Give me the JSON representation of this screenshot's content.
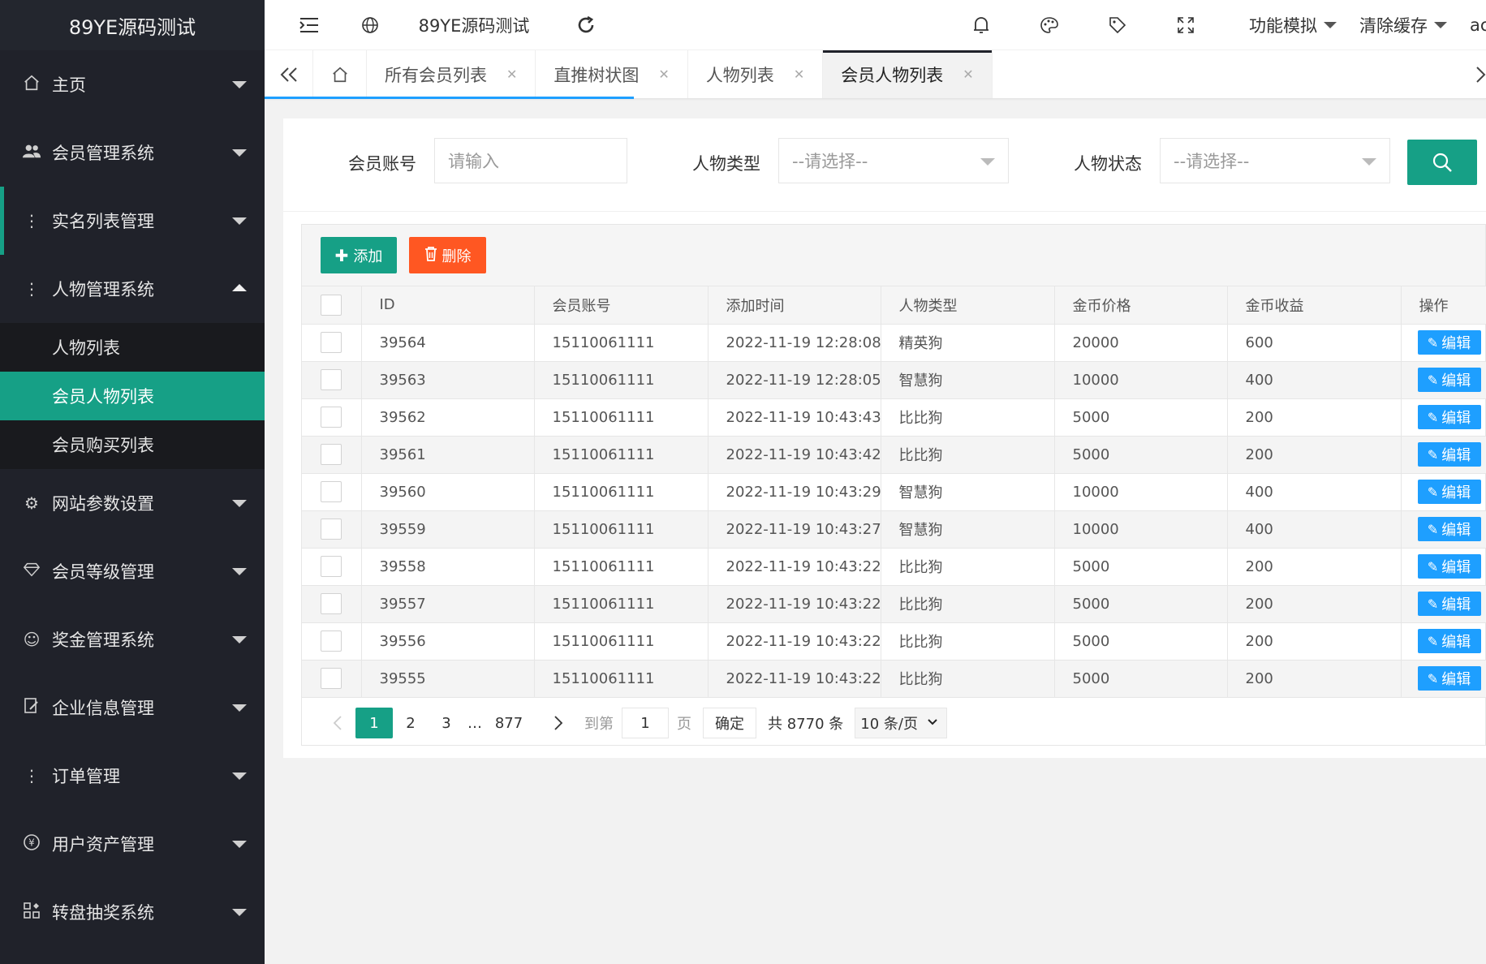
{
  "sidebar": {
    "logo": "89YE源码测试",
    "items": [
      {
        "label": "主页",
        "icon": "home-icon"
      },
      {
        "label": "会员管理系统",
        "icon": "users-icon"
      },
      {
        "label": "实名列表管理",
        "icon": "dots-vertical-icon"
      },
      {
        "label": "人物管理系统",
        "icon": "dots-vertical-icon"
      },
      {
        "label": "网站参数设置",
        "icon": "gear-icon"
      },
      {
        "label": "会员等级管理",
        "icon": "diamond-icon"
      },
      {
        "label": "奖金管理系统",
        "icon": "smile-icon"
      },
      {
        "label": "企业信息管理",
        "icon": "edit-doc-icon"
      },
      {
        "label": "订单管理",
        "icon": "dots-vertical-icon"
      },
      {
        "label": "用户资产管理",
        "icon": "yen-icon"
      },
      {
        "label": "转盘抽奖系统",
        "icon": "apps-icon"
      }
    ],
    "sub_items": [
      {
        "label": "人物列表"
      },
      {
        "label": "会员人物列表"
      },
      {
        "label": "会员购买列表"
      }
    ]
  },
  "topbar": {
    "title": "89YE源码测试",
    "dd_func": "功能模拟",
    "dd_cache": "清除缓存",
    "user_partial": "ac"
  },
  "tabs": [
    {
      "label": "所有会员列表"
    },
    {
      "label": "直推树状图"
    },
    {
      "label": "人物列表"
    },
    {
      "label": "会员人物列表"
    }
  ],
  "search": {
    "account_label": "会员账号",
    "account_placeholder": "请输入",
    "type_label": "人物类型",
    "type_placeholder": "--请选择--",
    "status_label": "人物状态",
    "status_placeholder": "--请选择--"
  },
  "toolbar": {
    "add_label": "添加",
    "delete_label": "删除"
  },
  "table": {
    "columns": [
      "ID",
      "会员账号",
      "添加时间",
      "人物类型",
      "金币价格",
      "金币收益",
      "操作"
    ],
    "edit_label": "编辑",
    "rows": [
      {
        "id": "39564",
        "account": "15110061111",
        "time": "2022-11-19 12:28:08",
        "type": "精英狗",
        "price": "20000",
        "income": "600"
      },
      {
        "id": "39563",
        "account": "15110061111",
        "time": "2022-11-19 12:28:05",
        "type": "智慧狗",
        "price": "10000",
        "income": "400"
      },
      {
        "id": "39562",
        "account": "15110061111",
        "time": "2022-11-19 10:43:43",
        "type": "比比狗",
        "price": "5000",
        "income": "200"
      },
      {
        "id": "39561",
        "account": "15110061111",
        "time": "2022-11-19 10:43:42",
        "type": "比比狗",
        "price": "5000",
        "income": "200"
      },
      {
        "id": "39560",
        "account": "15110061111",
        "time": "2022-11-19 10:43:29",
        "type": "智慧狗",
        "price": "10000",
        "income": "400"
      },
      {
        "id": "39559",
        "account": "15110061111",
        "time": "2022-11-19 10:43:27",
        "type": "智慧狗",
        "price": "10000",
        "income": "400"
      },
      {
        "id": "39558",
        "account": "15110061111",
        "time": "2022-11-19 10:43:22",
        "type": "比比狗",
        "price": "5000",
        "income": "200"
      },
      {
        "id": "39557",
        "account": "15110061111",
        "time": "2022-11-19 10:43:22",
        "type": "比比狗",
        "price": "5000",
        "income": "200"
      },
      {
        "id": "39556",
        "account": "15110061111",
        "time": "2022-11-19 10:43:22",
        "type": "比比狗",
        "price": "5000",
        "income": "200"
      },
      {
        "id": "39555",
        "account": "15110061111",
        "time": "2022-11-19 10:43:22",
        "type": "比比狗",
        "price": "5000",
        "income": "200"
      }
    ]
  },
  "pager": {
    "pages": [
      "1",
      "2",
      "3"
    ],
    "dots": "…",
    "last": "877",
    "goto_label": "到第",
    "goto_value": "1",
    "page_unit": "页",
    "confirm": "确定",
    "total": "共 8770 条",
    "size": "10 条/页"
  },
  "colors": {
    "sidebar_bg": "#20222a",
    "accent_green": "#16a086",
    "danger_orange": "#ff5722",
    "edit_blue": "#1e9fff"
  }
}
